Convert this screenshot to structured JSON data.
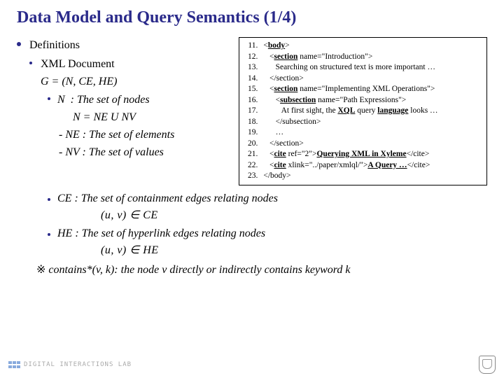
{
  "title": "Data Model and Query Semantics (1/4)",
  "left": {
    "definitions": "Definitions",
    "xmlDoc": "XML Document",
    "gdef": "G = (N, CE, HE)",
    "nLabel": "N",
    "nDesc": ": The set of nodes",
    "nEq": "N = NE  U  NV",
    "neDash": "- NE : The set of elements",
    "nvDash": "- NV : The set of values"
  },
  "code": {
    "start": 11,
    "lines": [
      {
        "indent": 0,
        "parts": [
          {
            "t": "<",
            "b": false
          },
          {
            "t": "body",
            "b": true,
            "u": true
          },
          {
            "t": ">",
            "b": false
          }
        ]
      },
      {
        "indent": 1,
        "parts": [
          {
            "t": "<",
            "b": false
          },
          {
            "t": "section",
            "b": true,
            "u": true
          },
          {
            "t": " name=\"Introduction\">",
            "b": false
          }
        ]
      },
      {
        "indent": 2,
        "parts": [
          {
            "t": "Searching on structured text is more important …",
            "b": false
          }
        ]
      },
      {
        "indent": 1,
        "parts": [
          {
            "t": "</section>",
            "b": false
          }
        ]
      },
      {
        "indent": 1,
        "parts": [
          {
            "t": "<",
            "b": false
          },
          {
            "t": "section",
            "b": true,
            "u": true
          },
          {
            "t": " name=\"Implementing XML Operations\">",
            "b": false
          }
        ]
      },
      {
        "indent": 2,
        "parts": [
          {
            "t": "<",
            "b": false
          },
          {
            "t": "subsection",
            "b": true,
            "u": true
          },
          {
            "t": " name=\"Path Expressions\">",
            "b": false
          }
        ]
      },
      {
        "indent": 3,
        "parts": [
          {
            "t": "At first sight, the ",
            "b": false
          },
          {
            "t": "XQL",
            "b": true,
            "u": true
          },
          {
            "t": " query ",
            "b": false
          },
          {
            "t": "language",
            "b": true,
            "u": true
          },
          {
            "t": " looks …",
            "b": false
          }
        ]
      },
      {
        "indent": 2,
        "parts": [
          {
            "t": "</subsection>",
            "b": false
          }
        ]
      },
      {
        "indent": 2,
        "parts": [
          {
            "t": "…",
            "b": false
          }
        ]
      },
      {
        "indent": 1,
        "parts": [
          {
            "t": "</section>",
            "b": false
          }
        ]
      },
      {
        "indent": 1,
        "parts": [
          {
            "t": "<",
            "b": false
          },
          {
            "t": "cite",
            "b": true,
            "u": true
          },
          {
            "t": " ref=\"2\">",
            "b": false
          },
          {
            "t": "Querying XML in Xyleme",
            "b": true,
            "u": true
          },
          {
            "t": "</cite>",
            "b": false
          }
        ]
      },
      {
        "indent": 1,
        "parts": [
          {
            "t": "<",
            "b": false
          },
          {
            "t": "cite",
            "b": true,
            "u": true
          },
          {
            "t": " xlink=\"../paper/xmlql/\">",
            "b": false
          },
          {
            "t": "A Query …",
            "b": true,
            "u": true
          },
          {
            "t": "</cite>",
            "b": false
          }
        ]
      },
      {
        "indent": 0,
        "parts": [
          {
            "t": "</body>",
            "b": false
          }
        ]
      }
    ]
  },
  "below": {
    "ceLabel": "CE",
    "ceDesc": ": The set of containment edges relating nodes",
    "ceFormula": "(u, v) ∈ CE",
    "heLabel": "HE",
    "heDesc": ": The set of hyperlink edges relating nodes",
    "heFormula": "(u, v) ∈ HE",
    "containsPrefix": "※ ",
    "containsBody": "contains*(v, k)",
    "containsRest": ": the node v directly or indirectly contains keyword k"
  },
  "footer": {
    "lab": "DIGITAL INTERACTIONS LAB"
  }
}
